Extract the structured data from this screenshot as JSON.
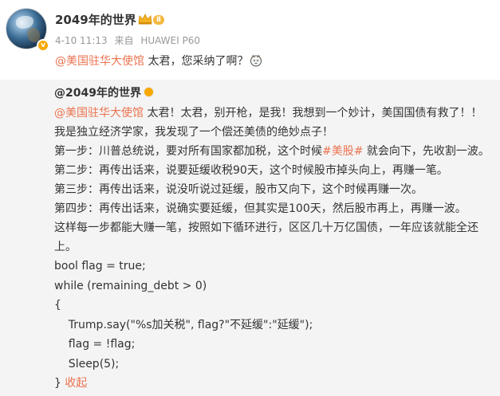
{
  "post": {
    "user_name": "2049年的世界",
    "level": "Ⅱ",
    "date": "4-10 11:13",
    "source_prefix": "来自",
    "source_device": "HUAWEI P60",
    "mention": "@美国驻华大使馆",
    "text": " 太君，您采纳了啊？"
  },
  "repost": {
    "user_name": "@2049年的世界",
    "line1_mention": "@美国驻华大使馆",
    "line1_text": " 太君！太君，别开枪，是我！我想到一个妙计，美国国债有救了！！",
    "line2": "我是独立经济学家，我发现了一个偿还美债的绝妙点子！",
    "line3_pre": "第一步：川普总统说，要对所有国家都加税，这个时候",
    "line3_tag": "#美股#",
    "line3_post": " 就会向下，先收割一波。",
    "line4": "第二步：再传出话来，说要延缓收税90天，这个时候股市掉头向上，再赚一笔。",
    "line5": "第三步：再传出话来，说没听说过延缓，股市又向下，这个时候再赚一次。",
    "line6": "第四步：再传出话来，说确实要延缓，但其实是100天，然后股市再上，再赚一波。",
    "line7": "这样每一步都能大赚一笔，按照如下循环进行，区区几十万亿国债，一年应该就能全还上。",
    "code1": "bool flag = true;",
    "code2": "while (remaining_debt > 0)",
    "code3": "{",
    "code4": "    Trump.say(\"%s加关税\", flag?\"不延缓\":\"延缓\");",
    "code5": "    flag = !flag;",
    "code6": "    Sleep(5);",
    "code7": "}",
    "collapse_label": "收起"
  },
  "colors": {
    "accent": "#eb7350",
    "repost_bg": "#f4f4f4",
    "meta": "#999999"
  },
  "icons": [
    "avatar",
    "verified-badge-icon",
    "crown-icon",
    "doge-icon"
  ]
}
